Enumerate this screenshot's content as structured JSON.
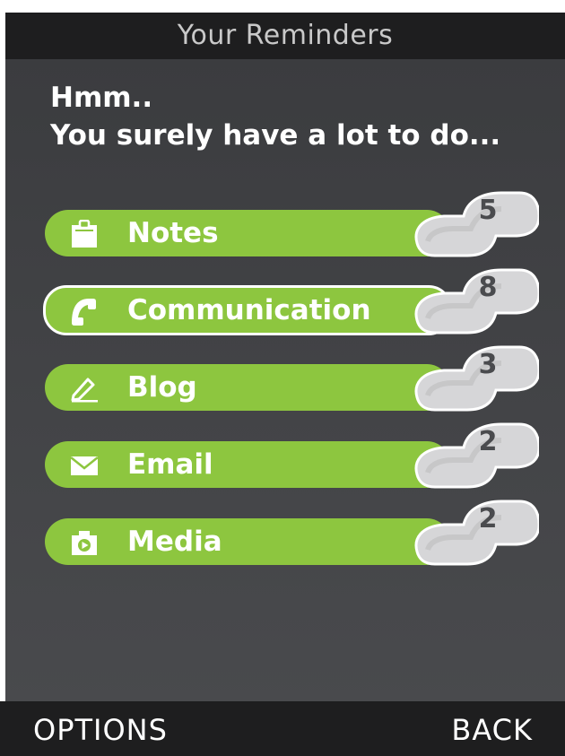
{
  "header": {
    "title": "Your Reminders"
  },
  "message": {
    "line1": "Hmm..",
    "line2": "You surely have a lot to do..."
  },
  "reminders": [
    {
      "label": "Notes",
      "count": "5",
      "icon": "clipboard-icon",
      "selected": false
    },
    {
      "label": "Communication",
      "count": "8",
      "icon": "phone-icon",
      "selected": true
    },
    {
      "label": "Blog",
      "count": "3",
      "icon": "pen-icon",
      "selected": false
    },
    {
      "label": "Email",
      "count": "2",
      "icon": "envelope-icon",
      "selected": false
    },
    {
      "label": "Media",
      "count": "2",
      "icon": "camera-icon",
      "selected": false
    }
  ],
  "softkeys": {
    "left": "OPTIONS",
    "right": "BACK"
  },
  "colors": {
    "accent": "#8dc63f",
    "titlebar": "#1e1e1f",
    "background": "#444548",
    "badge": "#d4d4d6"
  }
}
